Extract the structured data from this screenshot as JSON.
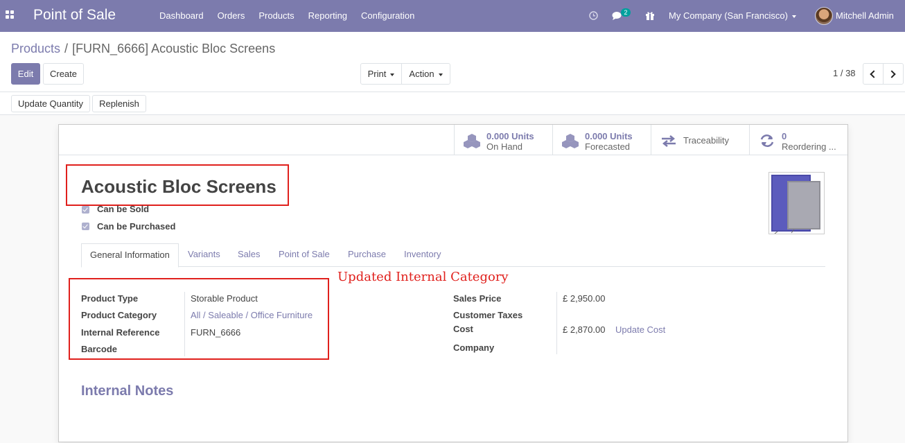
{
  "navbar": {
    "brand": "Point of Sale",
    "menu": [
      "Dashboard",
      "Orders",
      "Products",
      "Reporting",
      "Configuration"
    ],
    "messages_count": "2",
    "company": "My Company (San Francisco)",
    "user": "Mitchell Admin"
  },
  "breadcrumb": {
    "parent": "Products",
    "separator": "/",
    "current": "[FURN_6666] Acoustic Bloc Screens"
  },
  "actions": {
    "edit": "Edit",
    "create": "Create",
    "print": "Print",
    "action": "Action",
    "pager": "1 / 38",
    "update_quantity": "Update Quantity",
    "replenish": "Replenish"
  },
  "stats": [
    {
      "value": "0.000 Units",
      "label": "On Hand",
      "icon": "cubes-icon"
    },
    {
      "value": "0.000 Units",
      "label": "Forecasted",
      "icon": "cubes-icon"
    },
    {
      "label": "Traceability",
      "icon": "exchange-icon"
    },
    {
      "value": "0",
      "label": "Reordering ...",
      "icon": "refresh-icon"
    }
  ],
  "product": {
    "name": "Acoustic Bloc Screens",
    "can_be_sold": "Can be Sold",
    "can_be_purchased": "Can be Purchased"
  },
  "tabs": [
    "General Information",
    "Variants",
    "Sales",
    "Point of Sale",
    "Purchase",
    "Inventory"
  ],
  "annotation": "Updated Internal Category",
  "fields_left": [
    {
      "label": "Product Type",
      "value": "Storable Product"
    },
    {
      "label": "Product Category",
      "value": "All / Saleable / Office Furniture"
    },
    {
      "label": "Internal Reference",
      "value": "FURN_6666"
    },
    {
      "label": "Barcode",
      "value": ""
    }
  ],
  "fields_right": [
    {
      "label": "Sales Price",
      "value": "£ 2,950.00"
    },
    {
      "label": "Customer Taxes",
      "value": ""
    },
    {
      "label": "Cost",
      "value": "£ 2,870.00",
      "action": "Update Cost"
    },
    {
      "label": "Company",
      "value": ""
    }
  ],
  "internal_notes": "Internal Notes",
  "colors": {
    "brand": "#7c7bad",
    "highlight": "#e0201c",
    "badge": "#00a09d"
  }
}
